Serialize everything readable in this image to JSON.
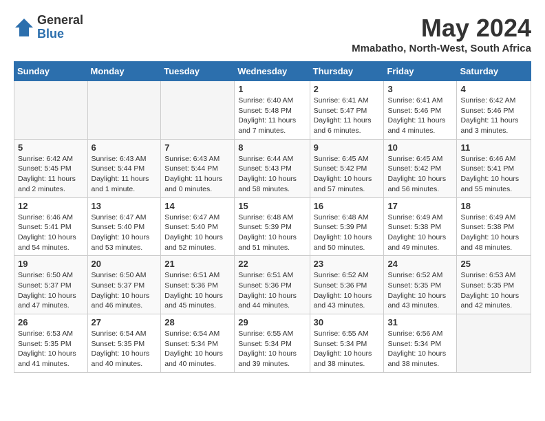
{
  "logo": {
    "general": "General",
    "blue": "Blue"
  },
  "title": {
    "month": "May 2024",
    "location": "Mmabatho, North-West, South Africa"
  },
  "headers": [
    "Sunday",
    "Monday",
    "Tuesday",
    "Wednesday",
    "Thursday",
    "Friday",
    "Saturday"
  ],
  "weeks": [
    [
      {
        "day": "",
        "info": ""
      },
      {
        "day": "",
        "info": ""
      },
      {
        "day": "",
        "info": ""
      },
      {
        "day": "1",
        "info": "Sunrise: 6:40 AM\nSunset: 5:48 PM\nDaylight: 11 hours\nand 7 minutes."
      },
      {
        "day": "2",
        "info": "Sunrise: 6:41 AM\nSunset: 5:47 PM\nDaylight: 11 hours\nand 6 minutes."
      },
      {
        "day": "3",
        "info": "Sunrise: 6:41 AM\nSunset: 5:46 PM\nDaylight: 11 hours\nand 4 minutes."
      },
      {
        "day": "4",
        "info": "Sunrise: 6:42 AM\nSunset: 5:46 PM\nDaylight: 11 hours\nand 3 minutes."
      }
    ],
    [
      {
        "day": "5",
        "info": "Sunrise: 6:42 AM\nSunset: 5:45 PM\nDaylight: 11 hours\nand 2 minutes."
      },
      {
        "day": "6",
        "info": "Sunrise: 6:43 AM\nSunset: 5:44 PM\nDaylight: 11 hours\nand 1 minute."
      },
      {
        "day": "7",
        "info": "Sunrise: 6:43 AM\nSunset: 5:44 PM\nDaylight: 11 hours\nand 0 minutes."
      },
      {
        "day": "8",
        "info": "Sunrise: 6:44 AM\nSunset: 5:43 PM\nDaylight: 10 hours\nand 58 minutes."
      },
      {
        "day": "9",
        "info": "Sunrise: 6:45 AM\nSunset: 5:42 PM\nDaylight: 10 hours\nand 57 minutes."
      },
      {
        "day": "10",
        "info": "Sunrise: 6:45 AM\nSunset: 5:42 PM\nDaylight: 10 hours\nand 56 minutes."
      },
      {
        "day": "11",
        "info": "Sunrise: 6:46 AM\nSunset: 5:41 PM\nDaylight: 10 hours\nand 55 minutes."
      }
    ],
    [
      {
        "day": "12",
        "info": "Sunrise: 6:46 AM\nSunset: 5:41 PM\nDaylight: 10 hours\nand 54 minutes."
      },
      {
        "day": "13",
        "info": "Sunrise: 6:47 AM\nSunset: 5:40 PM\nDaylight: 10 hours\nand 53 minutes."
      },
      {
        "day": "14",
        "info": "Sunrise: 6:47 AM\nSunset: 5:40 PM\nDaylight: 10 hours\nand 52 minutes."
      },
      {
        "day": "15",
        "info": "Sunrise: 6:48 AM\nSunset: 5:39 PM\nDaylight: 10 hours\nand 51 minutes."
      },
      {
        "day": "16",
        "info": "Sunrise: 6:48 AM\nSunset: 5:39 PM\nDaylight: 10 hours\nand 50 minutes."
      },
      {
        "day": "17",
        "info": "Sunrise: 6:49 AM\nSunset: 5:38 PM\nDaylight: 10 hours\nand 49 minutes."
      },
      {
        "day": "18",
        "info": "Sunrise: 6:49 AM\nSunset: 5:38 PM\nDaylight: 10 hours\nand 48 minutes."
      }
    ],
    [
      {
        "day": "19",
        "info": "Sunrise: 6:50 AM\nSunset: 5:37 PM\nDaylight: 10 hours\nand 47 minutes."
      },
      {
        "day": "20",
        "info": "Sunrise: 6:50 AM\nSunset: 5:37 PM\nDaylight: 10 hours\nand 46 minutes."
      },
      {
        "day": "21",
        "info": "Sunrise: 6:51 AM\nSunset: 5:36 PM\nDaylight: 10 hours\nand 45 minutes."
      },
      {
        "day": "22",
        "info": "Sunrise: 6:51 AM\nSunset: 5:36 PM\nDaylight: 10 hours\nand 44 minutes."
      },
      {
        "day": "23",
        "info": "Sunrise: 6:52 AM\nSunset: 5:36 PM\nDaylight: 10 hours\nand 43 minutes."
      },
      {
        "day": "24",
        "info": "Sunrise: 6:52 AM\nSunset: 5:35 PM\nDaylight: 10 hours\nand 43 minutes."
      },
      {
        "day": "25",
        "info": "Sunrise: 6:53 AM\nSunset: 5:35 PM\nDaylight: 10 hours\nand 42 minutes."
      }
    ],
    [
      {
        "day": "26",
        "info": "Sunrise: 6:53 AM\nSunset: 5:35 PM\nDaylight: 10 hours\nand 41 minutes."
      },
      {
        "day": "27",
        "info": "Sunrise: 6:54 AM\nSunset: 5:35 PM\nDaylight: 10 hours\nand 40 minutes."
      },
      {
        "day": "28",
        "info": "Sunrise: 6:54 AM\nSunset: 5:34 PM\nDaylight: 10 hours\nand 40 minutes."
      },
      {
        "day": "29",
        "info": "Sunrise: 6:55 AM\nSunset: 5:34 PM\nDaylight: 10 hours\nand 39 minutes."
      },
      {
        "day": "30",
        "info": "Sunrise: 6:55 AM\nSunset: 5:34 PM\nDaylight: 10 hours\nand 38 minutes."
      },
      {
        "day": "31",
        "info": "Sunrise: 6:56 AM\nSunset: 5:34 PM\nDaylight: 10 hours\nand 38 minutes."
      },
      {
        "day": "",
        "info": ""
      }
    ]
  ]
}
